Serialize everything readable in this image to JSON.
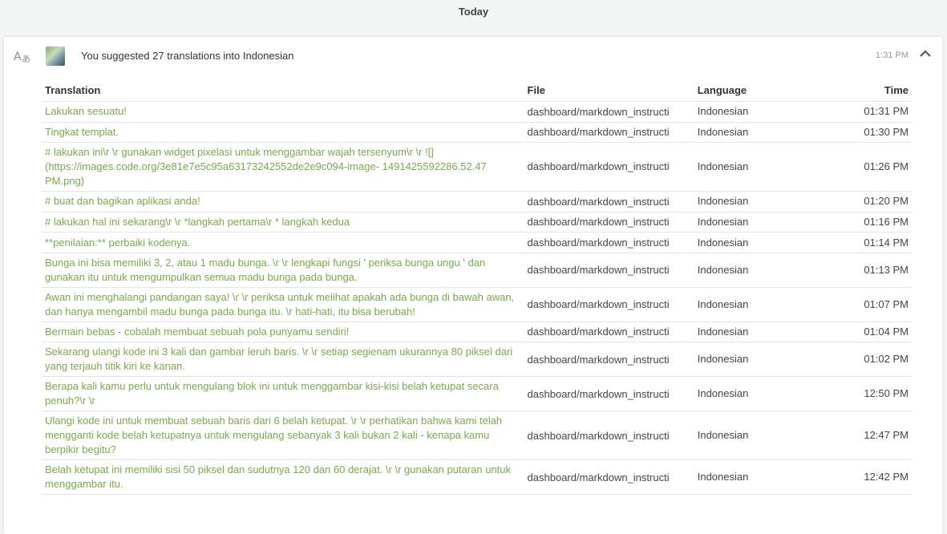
{
  "day_header": "Today",
  "activity": {
    "summary": "You suggested 27 translations into Indonesian",
    "time": "1:31 PM",
    "icon": "translate-icon",
    "collapse_icon": "chevron-up-icon"
  },
  "table": {
    "headers": {
      "translation": "Translation",
      "file": "File",
      "language": "Language",
      "time": "Time"
    },
    "rows": [
      {
        "translation": "Lakukan sesuatu!",
        "file": "dashboard/markdown_instructi",
        "language": "Indonesian",
        "time": "01:31 PM"
      },
      {
        "translation": "Tingkat templat.",
        "file": "dashboard/markdown_instructi",
        "language": "Indonesian",
        "time": "01:30 PM"
      },
      {
        "translation": "# lakukan ini\\r \\r gunakan widget pixelasi untuk menggambar wajah tersenyum\\r \\r ![] (https://images.code.org/3e81e7e5c95a63173242552de2e9c094-image- 1491425592286.52.47 PM.png)",
        "file": "dashboard/markdown_instructi",
        "language": "Indonesian",
        "time": "01:26 PM"
      },
      {
        "translation": "# buat dan bagikan aplikasi anda!",
        "file": "dashboard/markdown_instructi",
        "language": "Indonesian",
        "time": "01:20 PM"
      },
      {
        "translation": "# lakukan hal ini sekarang\\r \\r *langkah pertama\\r * langkah kedua",
        "file": "dashboard/markdown_instructi",
        "language": "Indonesian",
        "time": "01:16 PM"
      },
      {
        "translation": "**penilaian:** perbaiki kodenya.",
        "file": "dashboard/markdown_instructi",
        "language": "Indonesian",
        "time": "01:14 PM"
      },
      {
        "translation": "Bunga ini bisa memiliki 3, 2, atau 1 madu bunga. \\r \\r lengkapi fungsi ' periksa bunga ungu ' dan gunakan itu untuk mengumpulkan semua madu bunga pada bunga.",
        "file": "dashboard/markdown_instructi",
        "language": "Indonesian",
        "time": "01:13 PM"
      },
      {
        "translation": "Awan ini menghalangi pandangan saya! \\r \\r periksa untuk melihat apakah ada bunga di bawah awan, dan hanya mengambil madu bunga pada bunga itu. \\r hati-hati, itu bisa berubah!",
        "file": "dashboard/markdown_instructi",
        "language": "Indonesian",
        "time": "01:07 PM"
      },
      {
        "translation": "Bermain bebas - cobalah membuat sebuah pola punyamu sendiri!",
        "file": "dashboard/markdown_instructi",
        "language": "Indonesian",
        "time": "01:04 PM"
      },
      {
        "translation": "Sekarang ulangi kode ini 3 kali dan gambar leruh baris. \\r \\r setiap segienam ukurannya 80 piksel dari yang terjauh titik kiri ke kanan.",
        "file": "dashboard/markdown_instructi",
        "language": "Indonesian",
        "time": "01:02 PM"
      },
      {
        "translation": "Berapa kali kamu perlu untuk mengulang blok ini untuk menggambar kisi-kisi belah ketupat secara penuh?\\r \\r",
        "file": "dashboard/markdown_instructi",
        "language": "Indonesian",
        "time": "12:50 PM"
      },
      {
        "translation": "Ulangi kode ini untuk membuat sebuah baris dari 6 belah ketupat. \\r \\r perhatikan bahwa kami telah mengganti kode belah ketupatnya untuk mengulang sebanyak 3 kali bukan 2 kali - kenapa kamu berpikir begitu?",
        "file": "dashboard/markdown_instructi",
        "language": "Indonesian",
        "time": "12:47 PM"
      },
      {
        "translation": "Belah ketupat ini memiliki sisi 50 piksel dan sudutnya 120 dan 60 derajat. \\r \\r gunakan putaran untuk menggambar itu.",
        "file": "dashboard/markdown_instructi",
        "language": "Indonesian",
        "time": "12:42 PM"
      }
    ]
  },
  "colors": {
    "link": "#7aa84a",
    "accent_background": "#f3f4f4"
  }
}
